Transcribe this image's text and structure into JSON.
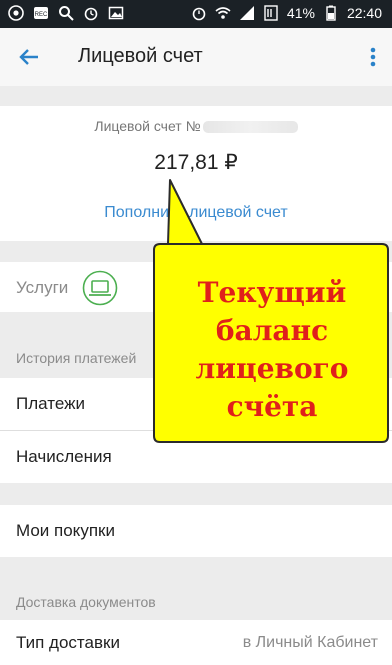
{
  "status_bar": {
    "battery": "41%",
    "time": "22:40",
    "icons_left": [
      "chrome-icon",
      "rec-icon",
      "search-icon",
      "alarm-icon",
      "image-icon"
    ],
    "icons_right": [
      "alarm-icon",
      "wifi-icon",
      "signal-icon",
      "mute-icon",
      "battery-icon"
    ]
  },
  "toolbar": {
    "title": "Лицевой счет"
  },
  "account": {
    "label": "Лицевой счет №",
    "balance": "217,81 ₽",
    "topup_label": "Пополнить лицевой счет"
  },
  "services": {
    "label": "Услуги"
  },
  "history": {
    "section_title": "История платежей",
    "payments": "Платежи",
    "charges": "Начисления"
  },
  "purchases": {
    "label": "Мои покупки"
  },
  "delivery": {
    "section_title": "Доставка документов",
    "type_label": "Тип доставки",
    "type_value": "в Личный Кабинет"
  },
  "callout": {
    "text": "Текущий баланс лицевого счёта",
    "fill": "#ffff00",
    "border": "#2b2b2b",
    "text_color": "#e0201b"
  }
}
